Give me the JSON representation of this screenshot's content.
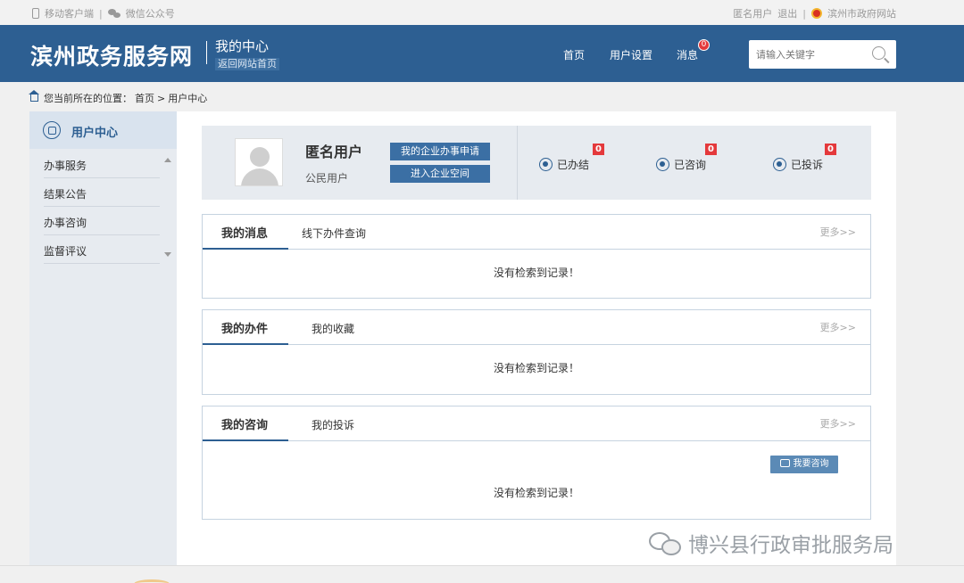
{
  "topbar": {
    "mobile_client": "移动客户端",
    "wechat": "微信公众号",
    "sep": "|",
    "anon_user": "匿名用户",
    "logout": "退出",
    "city_site": "滨州市政府网站"
  },
  "header": {
    "site_title": "滨州政务服务网",
    "center_title": "我的中心",
    "back_home": "返回网站首页",
    "nav": {
      "home": "首页",
      "settings": "用户设置",
      "messages": "消息",
      "message_count": "0"
    },
    "search": {
      "placeholder": "请输入关键字",
      "value": ""
    }
  },
  "breadcrumb": {
    "prefix": "您当前所在的位置：",
    "home": "首页",
    "sep": ">",
    "current": "用户中心"
  },
  "sidebar": {
    "title": "用户中心",
    "items": [
      {
        "label": "办事服务"
      },
      {
        "label": "结果公告"
      },
      {
        "label": "办事咨询"
      },
      {
        "label": "监督评议"
      }
    ]
  },
  "user": {
    "name": "匿名用户",
    "type": "公民用户",
    "apply_button": "我的企业办事申请",
    "space_button": "进入企业空间",
    "stats": [
      {
        "label": "已办结",
        "count": "0",
        "icon": "done-icon"
      },
      {
        "label": "已咨询",
        "count": "0",
        "icon": "consult-icon"
      },
      {
        "label": "已投诉",
        "count": "0",
        "icon": "complaint-icon"
      }
    ]
  },
  "boxes": [
    {
      "active_tab": "我的消息",
      "other_tab": "线下办件查询",
      "more": "更多>>",
      "empty": "没有检索到记录！"
    },
    {
      "active_tab": "我的办件",
      "other_tab": "我的收藏",
      "more": "更多>>",
      "empty": "没有检索到记录！"
    },
    {
      "active_tab": "我的咨询",
      "other_tab": "我的投诉",
      "more": "更多>>",
      "empty": "没有检索到记录！",
      "consult_button": "我要咨询"
    }
  ],
  "watermark": "博兴县行政审批服务局",
  "colors": {
    "header_bg": "#2d5f92",
    "button_blue": "#3b6fa4",
    "badge_red": "#e4393c",
    "panel_bg": "#e7ebf0"
  }
}
